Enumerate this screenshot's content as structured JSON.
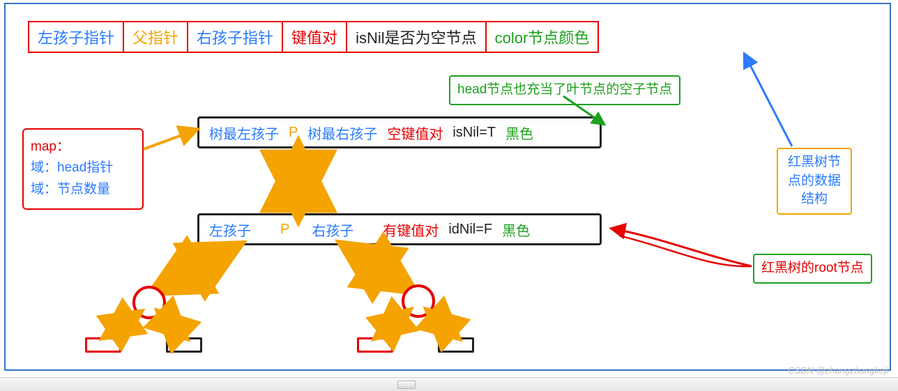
{
  "legend": {
    "items": [
      {
        "text": "左孩子指针",
        "cls": "c-blue"
      },
      {
        "text": "父指针",
        "cls": "c-orange"
      },
      {
        "text": "右孩子指针",
        "cls": "c-blue"
      },
      {
        "text": "键值对",
        "cls": "c-red"
      },
      {
        "text": "isNil是否为空节点",
        "cls": "c-black"
      },
      {
        "text": "color节点颜色",
        "cls": "c-green"
      }
    ]
  },
  "mapbox": {
    "title": "map：",
    "line1": "域：head指针",
    "line2": "域：节点数量"
  },
  "head_node": {
    "left": "树最左孩子",
    "parent": "P",
    "right": "树最右孩子",
    "kv": "空键值对",
    "isnil": "isNil=T",
    "color": "黑色"
  },
  "root_node": {
    "left": "左孩子",
    "parent": "P",
    "right": "右孩子",
    "kv": "有键值对",
    "isnil": "idNil=F",
    "color": "黑色"
  },
  "notes": {
    "head_annotation": "head节点也充当了叶节点的空子节点",
    "struct_annotation": "红黑树节点的数据结构",
    "root_annotation": "红黑树的root节点"
  },
  "watermark": "CSDN @zhangzhangkeji"
}
